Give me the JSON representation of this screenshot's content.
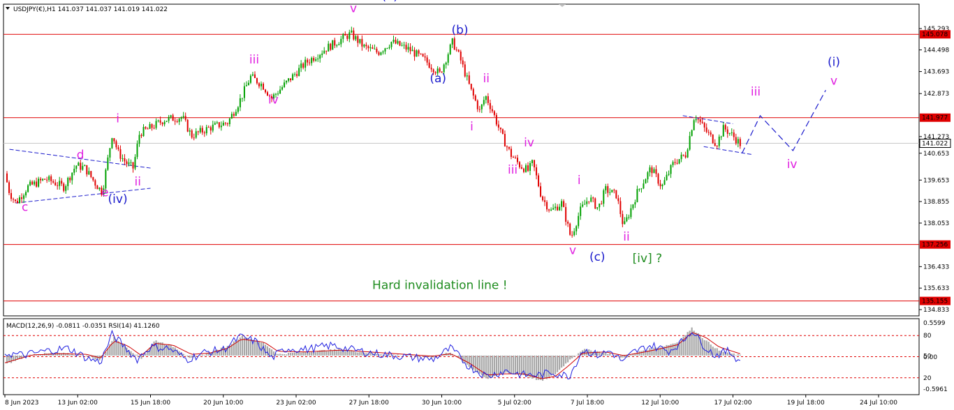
{
  "header": {
    "symbol_line": "USDJPY(€),H1  141.037 141.037 141.019 141.022",
    "indicator_line": "MACD(12,26,9) -0.0811 -0.0351  RSI(14) 41.1260"
  },
  "colors": {
    "bull": "#00a000",
    "bear": "#e00000",
    "level_line": "#e00000",
    "magenta": "#e020e0",
    "blue": "#1a1acc",
    "green": "#1e8c1e",
    "macd_hist": "#a8a8a8",
    "signal": "#d00000",
    "rsi": "#2020e0"
  },
  "chart_data": {
    "type": "candlestick",
    "symbol": "USDJPY(€)",
    "timeframe": "H1",
    "last": {
      "open": 141.037,
      "high": 141.037,
      "low": 141.019,
      "close": 141.022
    },
    "ylim": [
      134.6,
      146.2
    ],
    "price_ticks": [
      145.293,
      144.498,
      143.693,
      142.873,
      141.273,
      140.653,
      139.653,
      138.855,
      138.053,
      136.433,
      135.633,
      134.833
    ],
    "price_labels": [
      {
        "price": 145.078,
        "text": "145.078",
        "kind": "level"
      },
      {
        "price": 141.977,
        "text": "141.977",
        "kind": "level"
      },
      {
        "price": 141.022,
        "text": "141.022",
        "kind": "current"
      },
      {
        "price": 137.256,
        "text": "137.256",
        "kind": "level"
      },
      {
        "price": 135.155,
        "text": "135.155",
        "kind": "level"
      }
    ],
    "levels": [
      145.078,
      141.977,
      137.256,
      135.155
    ],
    "current_price": 141.022,
    "time_labels": [
      "8 Jun 2023",
      "13 Jun 02:00",
      "15 Jun 18:00",
      "20 Jun 10:00",
      "23 Jun 02:00",
      "27 Jun 18:00",
      "30 Jun 10:00",
      "5 Jul 02:00",
      "7 Jul 18:00",
      "12 Jul 10:00",
      "17 Jul 02:00",
      "19 Jul 18:00",
      "24 Jul 10:00"
    ],
    "x_range": [
      0,
      1
    ],
    "price_path": [
      [
        0.0,
        139.9
      ],
      [
        0.005,
        139.2
      ],
      [
        0.012,
        138.8
      ],
      [
        0.025,
        139.4
      ],
      [
        0.045,
        139.7
      ],
      [
        0.065,
        139.4
      ],
      [
        0.078,
        140.2
      ],
      [
        0.088,
        140.1
      ],
      [
        0.1,
        139.5
      ],
      [
        0.107,
        139.2
      ],
      [
        0.118,
        141.4
      ],
      [
        0.124,
        140.7
      ],
      [
        0.133,
        140.3
      ],
      [
        0.141,
        140.1
      ],
      [
        0.148,
        141.4
      ],
      [
        0.16,
        141.6
      ],
      [
        0.175,
        141.9
      ],
      [
        0.195,
        142.0
      ],
      [
        0.205,
        141.3
      ],
      [
        0.225,
        141.6
      ],
      [
        0.245,
        141.8
      ],
      [
        0.258,
        142.6
      ],
      [
        0.27,
        143.5
      ],
      [
        0.283,
        143.2
      ],
      [
        0.293,
        142.7
      ],
      [
        0.31,
        143.3
      ],
      [
        0.33,
        144.0
      ],
      [
        0.355,
        144.6
      ],
      [
        0.38,
        145.1
      ],
      [
        0.395,
        144.6
      ],
      [
        0.41,
        144.4
      ],
      [
        0.425,
        144.8
      ],
      [
        0.445,
        144.5
      ],
      [
        0.462,
        144.1
      ],
      [
        0.478,
        143.6
      ],
      [
        0.492,
        144.8
      ],
      [
        0.5,
        144.2
      ],
      [
        0.512,
        143.0
      ],
      [
        0.522,
        142.2
      ],
      [
        0.528,
        142.8
      ],
      [
        0.535,
        142.3
      ],
      [
        0.546,
        141.3
      ],
      [
        0.556,
        140.6
      ],
      [
        0.566,
        140.2
      ],
      [
        0.575,
        140.0
      ],
      [
        0.58,
        140.3
      ],
      [
        0.59,
        139.0
      ],
      [
        0.6,
        138.5
      ],
      [
        0.612,
        138.8
      ],
      [
        0.622,
        137.5
      ],
      [
        0.632,
        138.5
      ],
      [
        0.642,
        139.0
      ],
      [
        0.652,
        138.6
      ],
      [
        0.66,
        139.3
      ],
      [
        0.672,
        139.1
      ],
      [
        0.68,
        137.9
      ],
      [
        0.695,
        139.2
      ],
      [
        0.71,
        140.1
      ],
      [
        0.722,
        139.4
      ],
      [
        0.735,
        140.3
      ],
      [
        0.748,
        140.6
      ],
      [
        0.758,
        142.1
      ],
      [
        0.77,
        141.5
      ],
      [
        0.782,
        141.0
      ],
      [
        0.79,
        141.6
      ],
      [
        0.8,
        141.3
      ],
      [
        0.808,
        141.0
      ]
    ],
    "projection": [
      [
        0.81,
        140.65
      ],
      [
        0.83,
        142.05
      ],
      [
        0.866,
        140.75
      ],
      [
        0.902,
        143.0
      ]
    ],
    "wedges": [
      {
        "top": [
          [
            0.005,
            140.8
          ],
          [
            0.16,
            140.1
          ]
        ],
        "bottom": [
          [
            0.012,
            138.8
          ],
          [
            0.16,
            139.35
          ]
        ]
      },
      {
        "top": [
          [
            0.745,
            142.05
          ],
          [
            0.8,
            141.75
          ]
        ],
        "bottom": [
          [
            0.768,
            140.9
          ],
          [
            0.822,
            140.6
          ]
        ]
      }
    ],
    "wave_labels": [
      {
        "t": "c",
        "x": 0.022,
        "p": 138.5,
        "c": "magenta"
      },
      {
        "t": "d",
        "x": 0.083,
        "p": 140.45,
        "c": "magenta"
      },
      {
        "t": "e",
        "x": 0.11,
        "p": 139.05,
        "c": "magenta"
      },
      {
        "t": "(iv)",
        "x": 0.124,
        "p": 138.8,
        "c": "blue"
      },
      {
        "t": "i",
        "x": 0.124,
        "p": 141.8,
        "c": "magenta"
      },
      {
        "t": "ii",
        "x": 0.146,
        "p": 139.45,
        "c": "magenta"
      },
      {
        "t": "iii",
        "x": 0.274,
        "p": 144.0,
        "c": "magenta"
      },
      {
        "t": "iv",
        "x": 0.295,
        "p": 142.5,
        "c": "magenta"
      },
      {
        "t": "v",
        "x": 0.383,
        "p": 145.9,
        "c": "magenta"
      },
      {
        "t": "(v)",
        "x": 0.423,
        "p": 146.35,
        "c": "blue"
      },
      {
        "t": "(b)",
        "x": 0.5,
        "p": 145.1,
        "c": "blue"
      },
      {
        "t": "(a)",
        "x": 0.476,
        "p": 143.3,
        "c": "blue"
      },
      {
        "t": "ii",
        "x": 0.529,
        "p": 143.3,
        "c": "magenta"
      },
      {
        "t": "i",
        "x": 0.513,
        "p": 141.5,
        "c": "magenta"
      },
      {
        "t": "iv",
        "x": 0.576,
        "p": 140.9,
        "c": "magenta"
      },
      {
        "t": "iii",
        "x": 0.558,
        "p": 139.9,
        "c": "magenta"
      },
      {
        "t": "i",
        "x": 0.631,
        "p": 139.5,
        "c": "magenta"
      },
      {
        "t": "v",
        "x": 0.624,
        "p": 136.9,
        "c": "magenta"
      },
      {
        "t": "(c)",
        "x": 0.651,
        "p": 136.65,
        "c": "blue"
      },
      {
        "t": "ii",
        "x": 0.683,
        "p": 137.4,
        "c": "magenta"
      },
      {
        "t": "[iv] ?",
        "x": 0.706,
        "p": 136.6,
        "c": "green"
      },
      {
        "t": "iii",
        "x": 0.825,
        "p": 142.8,
        "c": "magenta"
      },
      {
        "t": "iv",
        "x": 0.865,
        "p": 140.1,
        "c": "magenta"
      },
      {
        "t": "(i)",
        "x": 0.911,
        "p": 143.9,
        "c": "blue"
      },
      {
        "t": "v",
        "x": 0.911,
        "p": 143.2,
        "c": "magenta"
      }
    ],
    "annotation": "Hard invalidation line !",
    "annotation_pos": {
      "x": 0.478,
      "p": 135.6
    },
    "indicator": {
      "ylim": [
        -0.5961,
        0.5599
      ],
      "axis_ticks": [
        "0.5599",
        "80",
        "50",
        "0.00",
        "20",
        "-0.5961"
      ],
      "rsi_levels": [
        80,
        50,
        20
      ],
      "rsi": [
        [
          0.0,
          55
        ],
        [
          0.02,
          52
        ],
        [
          0.045,
          58
        ],
        [
          0.07,
          62
        ],
        [
          0.09,
          48
        ],
        [
          0.105,
          42
        ],
        [
          0.118,
          82
        ],
        [
          0.13,
          66
        ],
        [
          0.145,
          46
        ],
        [
          0.16,
          64
        ],
        [
          0.18,
          62
        ],
        [
          0.2,
          46
        ],
        [
          0.22,
          56
        ],
        [
          0.24,
          60
        ],
        [
          0.258,
          78
        ],
        [
          0.275,
          72
        ],
        [
          0.293,
          48
        ],
        [
          0.31,
          62
        ],
        [
          0.33,
          60
        ],
        [
          0.36,
          66
        ],
        [
          0.38,
          60
        ],
        [
          0.41,
          54
        ],
        [
          0.44,
          50
        ],
        [
          0.47,
          46
        ],
        [
          0.49,
          62
        ],
        [
          0.51,
          36
        ],
        [
          0.53,
          22
        ],
        [
          0.55,
          30
        ],
        [
          0.57,
          24
        ],
        [
          0.59,
          24
        ],
        [
          0.6,
          28
        ],
        [
          0.62,
          22
        ],
        [
          0.635,
          60
        ],
        [
          0.652,
          52
        ],
        [
          0.665,
          58
        ],
        [
          0.68,
          42
        ],
        [
          0.69,
          56
        ],
        [
          0.71,
          66
        ],
        [
          0.73,
          58
        ],
        [
          0.745,
          72
        ],
        [
          0.755,
          88
        ],
        [
          0.765,
          70
        ],
        [
          0.78,
          52
        ],
        [
          0.795,
          58
        ],
        [
          0.808,
          44
        ]
      ],
      "macd_hist": [
        [
          0.0,
          -0.15
        ],
        [
          0.03,
          0.02
        ],
        [
          0.06,
          0.04
        ],
        [
          0.09,
          0.0
        ],
        [
          0.105,
          -0.08
        ],
        [
          0.12,
          0.3
        ],
        [
          0.135,
          0.12
        ],
        [
          0.15,
          -0.05
        ],
        [
          0.165,
          0.25
        ],
        [
          0.185,
          0.15
        ],
        [
          0.205,
          -0.05
        ],
        [
          0.225,
          0.05
        ],
        [
          0.245,
          0.15
        ],
        [
          0.26,
          0.32
        ],
        [
          0.285,
          0.2
        ],
        [
          0.3,
          0.02
        ],
        [
          0.33,
          0.06
        ],
        [
          0.37,
          0.1
        ],
        [
          0.4,
          0.04
        ],
        [
          0.44,
          0.0
        ],
        [
          0.47,
          -0.03
        ],
        [
          0.49,
          0.06
        ],
        [
          0.51,
          -0.18
        ],
        [
          0.53,
          -0.38
        ],
        [
          0.55,
          -0.28
        ],
        [
          0.57,
          -0.32
        ],
        [
          0.59,
          -0.42
        ],
        [
          0.605,
          -0.3
        ],
        [
          0.62,
          -0.08
        ],
        [
          0.635,
          0.1
        ],
        [
          0.66,
          0.05
        ],
        [
          0.68,
          -0.04
        ],
        [
          0.7,
          0.08
        ],
        [
          0.72,
          0.14
        ],
        [
          0.74,
          0.22
        ],
        [
          0.755,
          0.45
        ],
        [
          0.77,
          0.25
        ],
        [
          0.785,
          0.08
        ],
        [
          0.808,
          0.0
        ]
      ],
      "signal": [
        [
          0.0,
          -0.12
        ],
        [
          0.03,
          0.01
        ],
        [
          0.06,
          0.03
        ],
        [
          0.09,
          0.02
        ],
        [
          0.105,
          -0.04
        ],
        [
          0.12,
          0.24
        ],
        [
          0.135,
          0.16
        ],
        [
          0.15,
          0.0
        ],
        [
          0.165,
          0.2
        ],
        [
          0.185,
          0.17
        ],
        [
          0.205,
          0.02
        ],
        [
          0.225,
          0.04
        ],
        [
          0.245,
          0.12
        ],
        [
          0.26,
          0.27
        ],
        [
          0.285,
          0.22
        ],
        [
          0.3,
          0.07
        ],
        [
          0.33,
          0.06
        ],
        [
          0.37,
          0.09
        ],
        [
          0.4,
          0.06
        ],
        [
          0.44,
          0.02
        ],
        [
          0.47,
          -0.01
        ],
        [
          0.49,
          0.03
        ],
        [
          0.51,
          -0.12
        ],
        [
          0.53,
          -0.32
        ],
        [
          0.55,
          -0.3
        ],
        [
          0.57,
          -0.3
        ],
        [
          0.59,
          -0.38
        ],
        [
          0.605,
          -0.34
        ],
        [
          0.62,
          -0.16
        ],
        [
          0.635,
          0.04
        ],
        [
          0.66,
          0.06
        ],
        [
          0.68,
          0.0
        ],
        [
          0.7,
          0.05
        ],
        [
          0.72,
          0.11
        ],
        [
          0.74,
          0.18
        ],
        [
          0.755,
          0.38
        ],
        [
          0.77,
          0.3
        ],
        [
          0.785,
          0.14
        ],
        [
          0.808,
          0.03
        ]
      ]
    }
  }
}
